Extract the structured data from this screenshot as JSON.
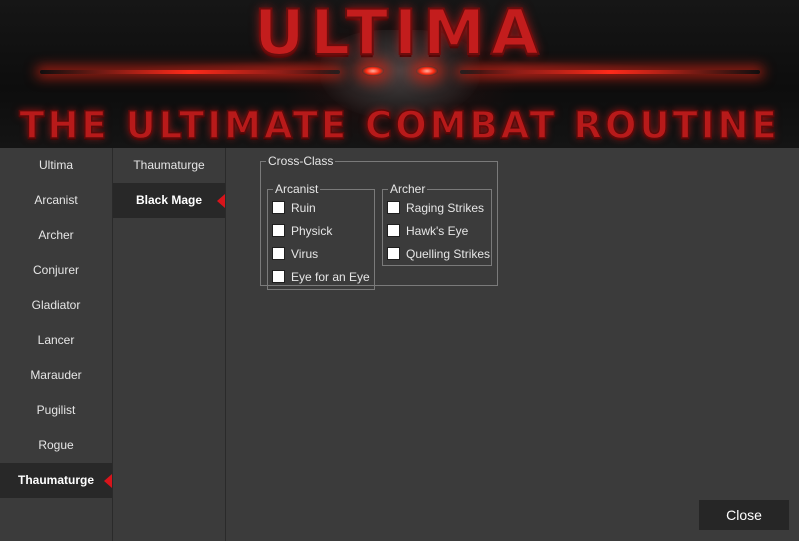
{
  "banner": {
    "title": "ULTIMA",
    "subtitle": "THE ULTIMATE COMBAT ROUTINE"
  },
  "class_list": {
    "items": [
      {
        "label": "Ultima",
        "selected": false
      },
      {
        "label": "Arcanist",
        "selected": false
      },
      {
        "label": "Archer",
        "selected": false
      },
      {
        "label": "Conjurer",
        "selected": false
      },
      {
        "label": "Gladiator",
        "selected": false
      },
      {
        "label": "Lancer",
        "selected": false
      },
      {
        "label": "Marauder",
        "selected": false
      },
      {
        "label": "Pugilist",
        "selected": false
      },
      {
        "label": "Rogue",
        "selected": false
      },
      {
        "label": "Thaumaturge",
        "selected": true
      }
    ]
  },
  "sub_list": {
    "items": [
      {
        "label": "Thaumaturge",
        "selected": false
      },
      {
        "label": "Black Mage",
        "selected": true
      }
    ]
  },
  "cross_class": {
    "legend": "Cross-Class",
    "arcanist": {
      "legend": "Arcanist",
      "options": [
        {
          "label": "Ruin",
          "checked": false
        },
        {
          "label": "Physick",
          "checked": false
        },
        {
          "label": "Virus",
          "checked": false
        },
        {
          "label": "Eye for an Eye",
          "checked": false
        }
      ]
    },
    "archer": {
      "legend": "Archer",
      "options": [
        {
          "label": "Raging Strikes",
          "checked": false
        },
        {
          "label": "Hawk's Eye",
          "checked": false
        },
        {
          "label": "Quelling Strikes",
          "checked": false
        }
      ]
    }
  },
  "footer": {
    "close_label": "Close"
  },
  "colors": {
    "background": "#3b3b3b",
    "selected_bg": "#282828",
    "accent_red": "#d8141b"
  }
}
